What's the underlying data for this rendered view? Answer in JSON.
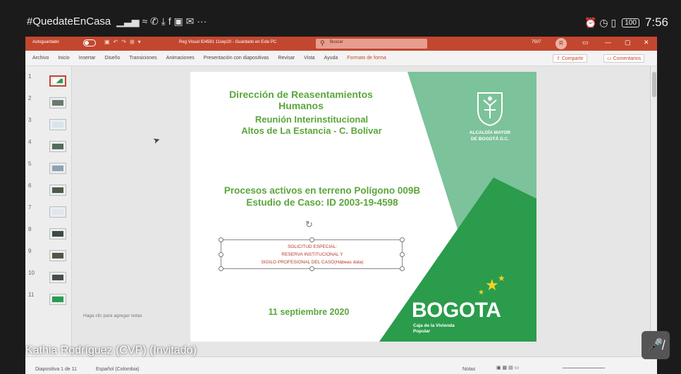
{
  "status_bar": {
    "hashtag": "#QuedateEnCasa",
    "left_icons": [
      "signal-icon",
      "wifi-icon",
      "phone-icon",
      "download-icon",
      "facebook-icon",
      "gallery-icon",
      "mail-icon",
      "more-icon"
    ],
    "left_icons_glyph": "▁▃▅ ≈ ✆ ⤓ f ▣ ✉ ···",
    "battery": "100",
    "time": "7:56"
  },
  "titlebar": {
    "autosave_label": "Autoguardado",
    "document": "Reg Visual ID4581 11sep20 - Guardado en Este PC",
    "search_placeholder": "Buscar",
    "account": "7507",
    "avatar": "R",
    "accent_color": "#c3472f"
  },
  "ribbon": {
    "tabs": [
      "Archivo",
      "Inicio",
      "Insertar",
      "Diseño",
      "Transiciones",
      "Animaciones",
      "Presentación con diapositivas",
      "Revisar",
      "Vista",
      "Ayuda"
    ],
    "special_tab": "Formato de forma",
    "share": "Compartir",
    "comments": "Comentarios"
  },
  "thumbnails": [
    "1",
    "2",
    "3",
    "4",
    "5",
    "6",
    "7",
    "8",
    "9",
    "10",
    "11"
  ],
  "slide": {
    "title": "Dirección de Reasentamientos Humanos",
    "meeting_line1": "Reunión Interinstitucional",
    "meeting_line2": "Altos de La Estancia - C. Bolívar",
    "process_line1": "Procesos activos en terreno Polígono 009B",
    "process_line2": "Estudio de Caso: ID 2003-19-4598",
    "textbox_line1": "SOLICITUD ESPECIAL:",
    "textbox_line2": "RESERVA INSTITUCIONAL Y",
    "textbox_line3": "SIGILO PROFESIONAL DEL CASO(Hábeas data)",
    "date": "11 septiembre 2020",
    "alcaldia_line1": "ALCALDÍA MAYOR",
    "alcaldia_line2": "DE BOGOTÁ D.C.",
    "brand": "BOGOTA",
    "caja_line1": "Caja de la Vivienda",
    "caja_line2": "Popular",
    "green_light": "#7cc29a",
    "green_dark": "#2a9c4c",
    "text_green": "#5aa63b"
  },
  "notes_hint": "Haga clic para agregar notas",
  "ppt_status": {
    "slide_count": "Diapositiva 1 de 11",
    "language": "Español (Colombia)",
    "notes": "Notas"
  },
  "meeting": {
    "participant": "Kathia Rodríguez (CVP) (Invitado)"
  }
}
